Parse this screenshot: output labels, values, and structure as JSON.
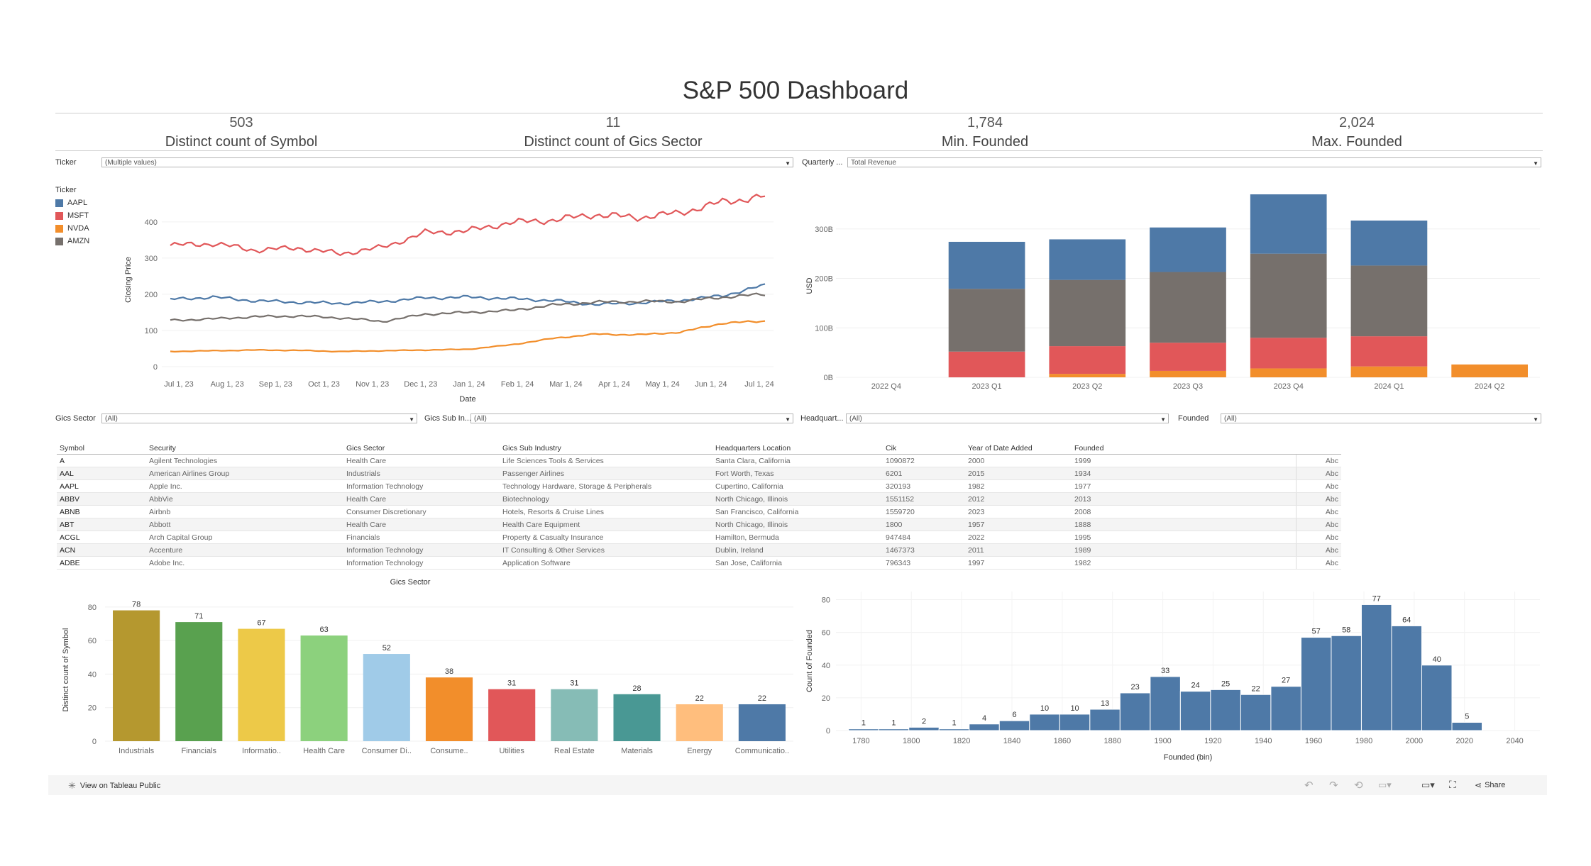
{
  "title": "S&P 500 Dashboard",
  "kpis": [
    {
      "value": "503",
      "label": "Distinct count of Symbol"
    },
    {
      "value": "11",
      "label": "Distinct count of Gics Sector"
    },
    {
      "value": "1,784",
      "label": "Min. Founded"
    },
    {
      "value": "2,024",
      "label": "Max. Founded"
    }
  ],
  "filters": {
    "ticker": {
      "label": "Ticker",
      "value": "(Multiple values)"
    },
    "quarterly": {
      "label": "Quarterly ...",
      "value": "Total Revenue"
    },
    "gics_sector": {
      "label": "Gics Sector",
      "value": "(All)"
    },
    "gics_sub": {
      "label": "Gics Sub In...",
      "value": "(All)"
    },
    "headquarters": {
      "label": "Headquart...",
      "value": "(All)"
    },
    "founded": {
      "label": "Founded",
      "value": "(All)"
    }
  },
  "legend": {
    "title": "Ticker",
    "items": [
      {
        "name": "AAPL",
        "color": "#4e79a7"
      },
      {
        "name": "MSFT",
        "color": "#e15759"
      },
      {
        "name": "NVDA",
        "color": "#f28e2b"
      },
      {
        "name": "AMZN",
        "color": "#76706c"
      }
    ]
  },
  "chart_data": [
    {
      "type": "line",
      "xlabel": "Date",
      "ylabel": "Closing Price",
      "ylim": [
        0,
        480
      ],
      "yticks": [
        0,
        100,
        200,
        300,
        400
      ],
      "x_ticks": [
        "Jul 1, 23",
        "Aug 1, 23",
        "Sep 1, 23",
        "Oct 1, 23",
        "Nov 1, 23",
        "Dec 1, 23",
        "Jan 1, 24",
        "Feb 1, 24",
        "Mar 1, 24",
        "Apr 1, 24",
        "May 1, 24",
        "Jun 1, 24",
        "Jul 1, 24"
      ],
      "x": [
        "Jun 23",
        "Jul 23",
        "Aug 23",
        "Sep 23",
        "Oct 23",
        "Nov 23",
        "Dec 23",
        "Jan 24",
        "Feb 24",
        "Mar 24",
        "Apr 24",
        "May 24",
        "Jun 24",
        "Jul 24"
      ],
      "series": [
        {
          "name": "MSFT",
          "values": [
            335,
            340,
            322,
            328,
            312,
            330,
            370,
            375,
            398,
            405,
            420,
            412,
            425,
            455,
            470
          ]
        },
        {
          "name": "AAPL",
          "values": [
            186,
            192,
            182,
            178,
            175,
            180,
            190,
            192,
            188,
            183,
            172,
            176,
            183,
            196,
            225
          ]
        },
        {
          "name": "AMZN",
          "values": [
            128,
            132,
            138,
            140,
            135,
            125,
            145,
            150,
            155,
            170,
            178,
            180,
            180,
            192,
            200
          ]
        },
        {
          "name": "NVDA",
          "values": [
            42,
            44,
            46,
            45,
            42,
            44,
            46,
            48,
            60,
            78,
            90,
            88,
            95,
            120,
            126
          ]
        }
      ]
    },
    {
      "type": "bar",
      "stacked": true,
      "ylabel": "USD",
      "yticks": [
        "0B",
        "100B",
        "200B",
        "300B"
      ],
      "ylim": [
        0,
        370
      ],
      "categories": [
        "2022 Q4",
        "2023 Q1",
        "2023 Q2",
        "2023 Q3",
        "2023 Q4",
        "2024 Q1",
        "2024 Q2"
      ],
      "series": [
        {
          "name": "NVDA",
          "values": [
            0,
            0,
            7,
            13,
            18,
            22,
            26
          ]
        },
        {
          "name": "MSFT",
          "values": [
            0,
            52,
            56,
            57,
            62,
            61,
            0
          ]
        },
        {
          "name": "AMZN",
          "values": [
            0,
            127,
            134,
            143,
            170,
            143,
            0
          ]
        },
        {
          "name": "AAPL",
          "values": [
            0,
            95,
            82,
            90,
            120,
            91,
            0
          ]
        }
      ]
    },
    {
      "type": "bar",
      "title": "Gics Sector",
      "ylabel": "Distinct count of Symbol",
      "ylim": [
        0,
        85
      ],
      "yticks": [
        0,
        20,
        40,
        60,
        80
      ],
      "categories": [
        "Industrials",
        "Financials",
        "Informatio..",
        "Health Care",
        "Consumer Di..",
        "Consume..",
        "Utilities",
        "Real Estate",
        "Materials",
        "Energy",
        "Communicatio.."
      ],
      "values": [
        78,
        71,
        67,
        63,
        52,
        38,
        31,
        31,
        28,
        22,
        22
      ],
      "colors": [
        "#b5982f",
        "#59a14f",
        "#edc948",
        "#8cd17d",
        "#a0cbe8",
        "#f28e2b",
        "#e15759",
        "#86bcb6",
        "#499894",
        "#ffbe7d",
        "#4e79a7"
      ]
    },
    {
      "type": "bar",
      "xlabel": "Founded (bin)",
      "ylabel": "Count of Founded",
      "ylim": [
        0,
        85
      ],
      "yticks": [
        0,
        20,
        40,
        60,
        80
      ],
      "x_ticks": [
        1780,
        1800,
        1820,
        1840,
        1860,
        1880,
        1900,
        1920,
        1940,
        1960,
        1980,
        2000,
        2020,
        2040
      ],
      "bin_starts": [
        1775,
        1787,
        1799,
        1811,
        1823,
        1835,
        1847,
        1859,
        1871,
        1883,
        1895,
        1907,
        1919,
        1931,
        1943,
        1955,
        1967,
        1979,
        1991,
        2003,
        2015
      ],
      "values": [
        1,
        1,
        2,
        1,
        4,
        6,
        10,
        10,
        13,
        23,
        33,
        24,
        25,
        22,
        27,
        57,
        58,
        77,
        64,
        40,
        5
      ],
      "color": "#4e79a7"
    }
  ],
  "table": {
    "columns": [
      "Symbol",
      "Security",
      "Gics Sector",
      "Gics Sub Industry",
      "Headquarters Location",
      "Cik",
      "Year of Date Added",
      "Founded"
    ],
    "rows": [
      [
        "A",
        "Agilent Technologies",
        "Health Care",
        "Life Sciences Tools & Services",
        "Santa Clara, California",
        "1090872",
        "2000",
        "1999"
      ],
      [
        "AAL",
        "American Airlines Group",
        "Industrials",
        "Passenger Airlines",
        "Fort Worth, Texas",
        "6201",
        "2015",
        "1934"
      ],
      [
        "AAPL",
        "Apple Inc.",
        "Information Technology",
        "Technology Hardware, Storage & Peripherals",
        "Cupertino, California",
        "320193",
        "1982",
        "1977"
      ],
      [
        "ABBV",
        "AbbVie",
        "Health Care",
        "Biotechnology",
        "North Chicago, Illinois",
        "1551152",
        "2012",
        "2013"
      ],
      [
        "ABNB",
        "Airbnb",
        "Consumer Discretionary",
        "Hotels, Resorts & Cruise Lines",
        "San Francisco, California",
        "1559720",
        "2023",
        "2008"
      ],
      [
        "ABT",
        "Abbott",
        "Health Care",
        "Health Care Equipment",
        "North Chicago, Illinois",
        "1800",
        "1957",
        "1888"
      ],
      [
        "ACGL",
        "Arch Capital Group",
        "Financials",
        "Property & Casualty Insurance",
        "Hamilton, Bermuda",
        "947484",
        "2022",
        "1995"
      ],
      [
        "ACN",
        "Accenture",
        "Information Technology",
        "IT Consulting & Other Services",
        "Dublin, Ireland",
        "1467373",
        "2011",
        "1989"
      ],
      [
        "ADBE",
        "Adobe Inc.",
        "Information Technology",
        "Application Software",
        "San Jose, California",
        "796343",
        "1997",
        "1982"
      ]
    ],
    "abc": "Abc"
  },
  "footer": {
    "view_label": "View on Tableau Public",
    "share_label": "Share"
  }
}
